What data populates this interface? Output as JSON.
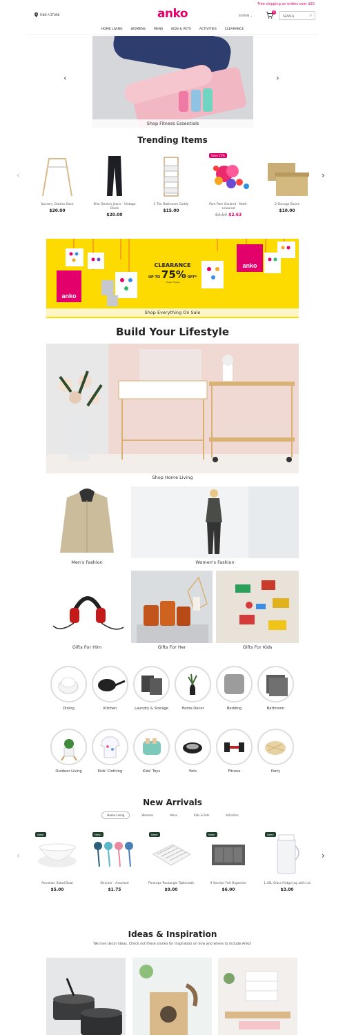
{
  "header": {
    "promo": "Free shipping on orders over $20",
    "find_store": "FIND A STORE",
    "logo": "anko",
    "sign_in": "SIGN IN",
    "cart_count": "0",
    "search_placeholder": "SEARCH"
  },
  "nav": [
    "HOME LIVING",
    "WOMENS",
    "MENS",
    "KIDS & PETS",
    "ACTIVITIES",
    "CLEARANCE"
  ],
  "hero": {
    "caption": "Shop Fitness Essentials"
  },
  "trending": {
    "title": "Trending Items",
    "items": [
      {
        "name": "Nursery Clothes Rack",
        "price": "$20.00"
      },
      {
        "name": "Slim Stretch Jeans - Vintage Black",
        "price": "$20.00"
      },
      {
        "name": "3 Tier Bathroom Caddy",
        "price": "$15.00"
      },
      {
        "name": "Pom Pom Garland - Multi-coloured",
        "old_price": "$3.50",
        "price": "$2.63",
        "tag": "Save 25%"
      },
      {
        "name": "2 Storage Boxes",
        "price": "$10.00"
      }
    ]
  },
  "clearance": {
    "title": "CLEARANCE",
    "up_to": "UP TO",
    "percent": "75%",
    "off": "OFF*",
    "note": "*Select Styles",
    "caption": "Shop Everything On Sale",
    "bag_word": "anko"
  },
  "lifestyle": {
    "title": "Build Your Lifestyle",
    "home_caption": "Shop Home Living",
    "mens": "Men's Fashion",
    "womens": "Women's Fashion",
    "him": "Gifts For Him",
    "her": "Gifts For Her",
    "kids": "Gifts For Kids"
  },
  "categories": [
    "Dining",
    "Kitchen",
    "Laundry & Storage",
    "Home Decor",
    "Bedding",
    "Bathroom",
    "Outdoor Living",
    "Kids' Clothing",
    "Kids' Toys",
    "Pets",
    "Fitness",
    "Party"
  ],
  "new_arrivals": {
    "title": "New Arrivals",
    "badge": "New!",
    "tabs": [
      "Home Living",
      "Womens",
      "Mens",
      "Kids & Pets",
      "Activities"
    ],
    "items": [
      {
        "name": "Porcelain Salad Bowl",
        "price": "$5.00"
      },
      {
        "name": "Strainer - Assorted",
        "price": "$1.75"
      },
      {
        "name": "Pinstripe Rectangle Tablecloth",
        "price": "$9.00"
      },
      {
        "name": "9 Section Felt Organiser",
        "price": "$6.00"
      },
      {
        "name": "1.45L Glass Fridge Jug with Lid",
        "price": "$3.00"
      }
    ]
  },
  "ideas": {
    "title": "Ideas & Inspiration",
    "subtitle": "We love decor ideas. Check out these stories for inspiration on how and where to include Anko!"
  },
  "colors": {
    "brand": "#e4006a",
    "yellow": "#fedb00"
  }
}
